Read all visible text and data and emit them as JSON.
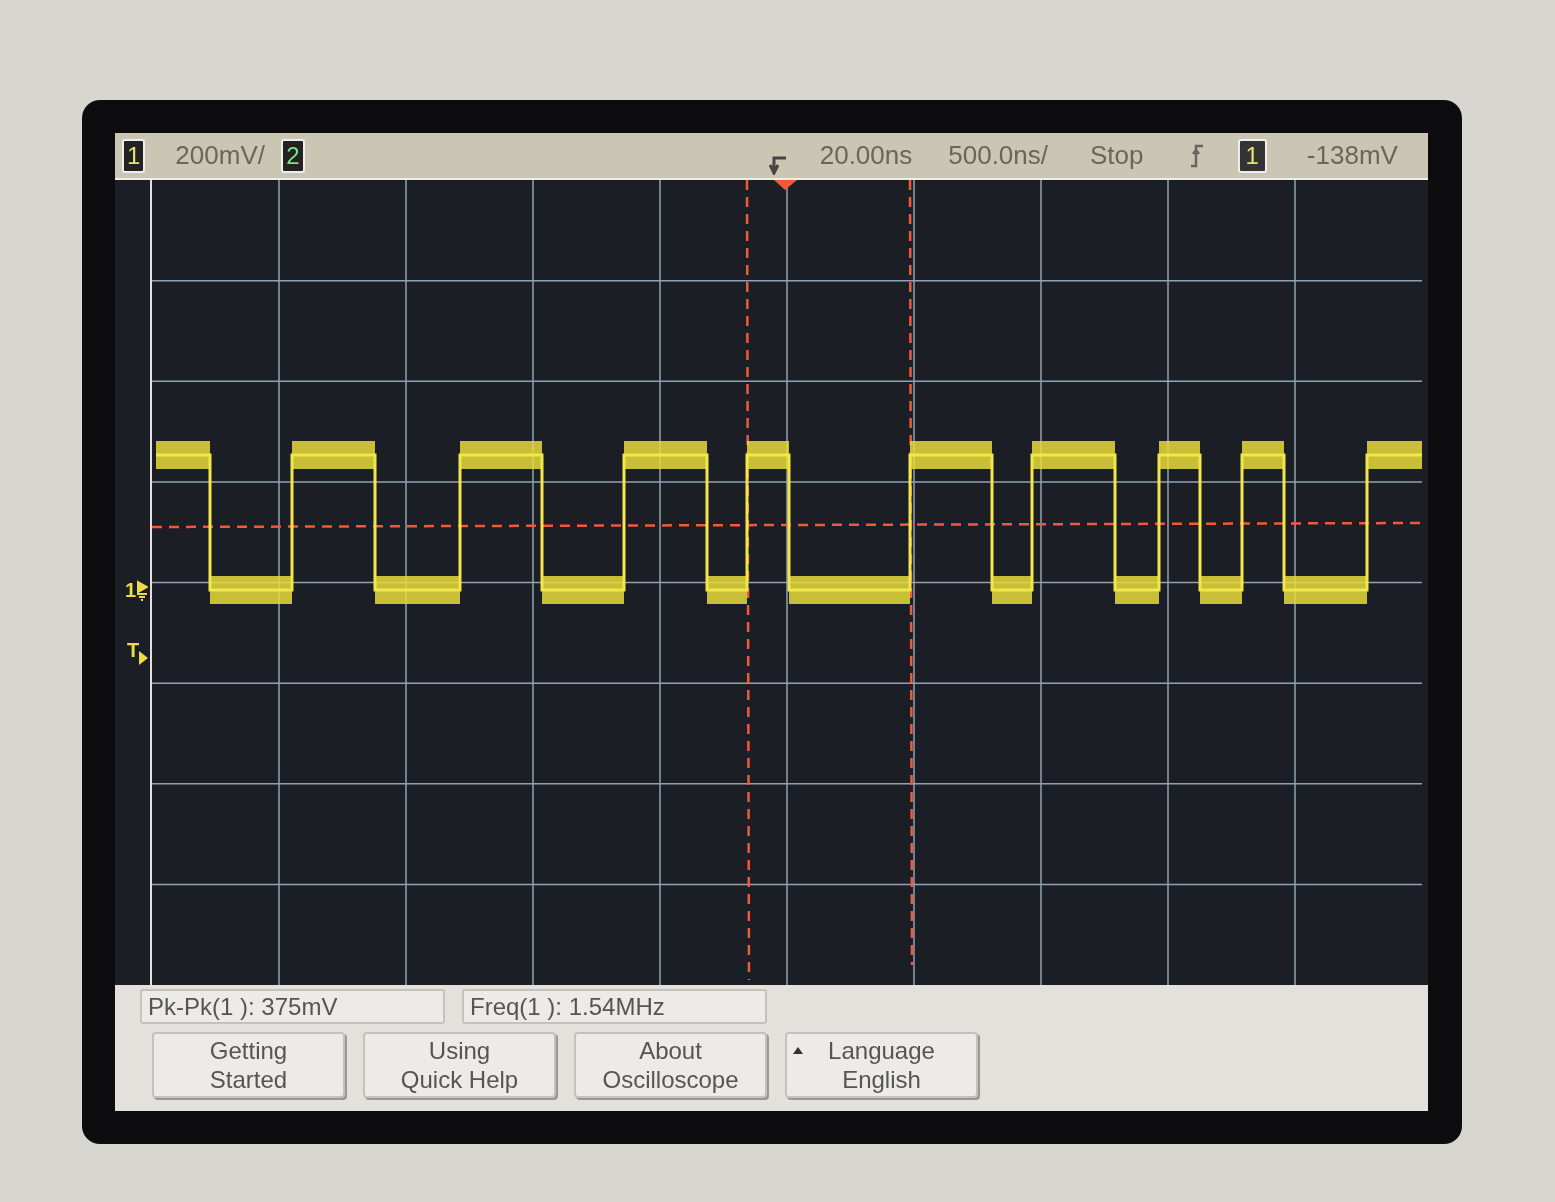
{
  "header": {
    "channel_1": "1",
    "volts_per_div": "200mV/",
    "channel_2": "2",
    "time_delay": "20.00ns",
    "time_per_div": "500.0ns/",
    "run_state": "Stop",
    "trigger_source": "1",
    "trigger_level": "-138mV"
  },
  "markers": {
    "channel_1": "1",
    "trigger": "T"
  },
  "measurements": [
    "Pk-Pk(1 ): 375mV",
    "Freq(1 ): 1.54MHz"
  ],
  "softkeys": [
    {
      "lines": [
        "Getting",
        "Started"
      ],
      "kind": "plain"
    },
    {
      "lines": [
        "Using",
        "Quick Help"
      ],
      "kind": "plain"
    },
    {
      "lines": [
        "About",
        "Oscilloscope"
      ],
      "kind": "plain"
    },
    {
      "lines": [
        "Language",
        "English"
      ],
      "kind": "menu"
    }
  ]
}
